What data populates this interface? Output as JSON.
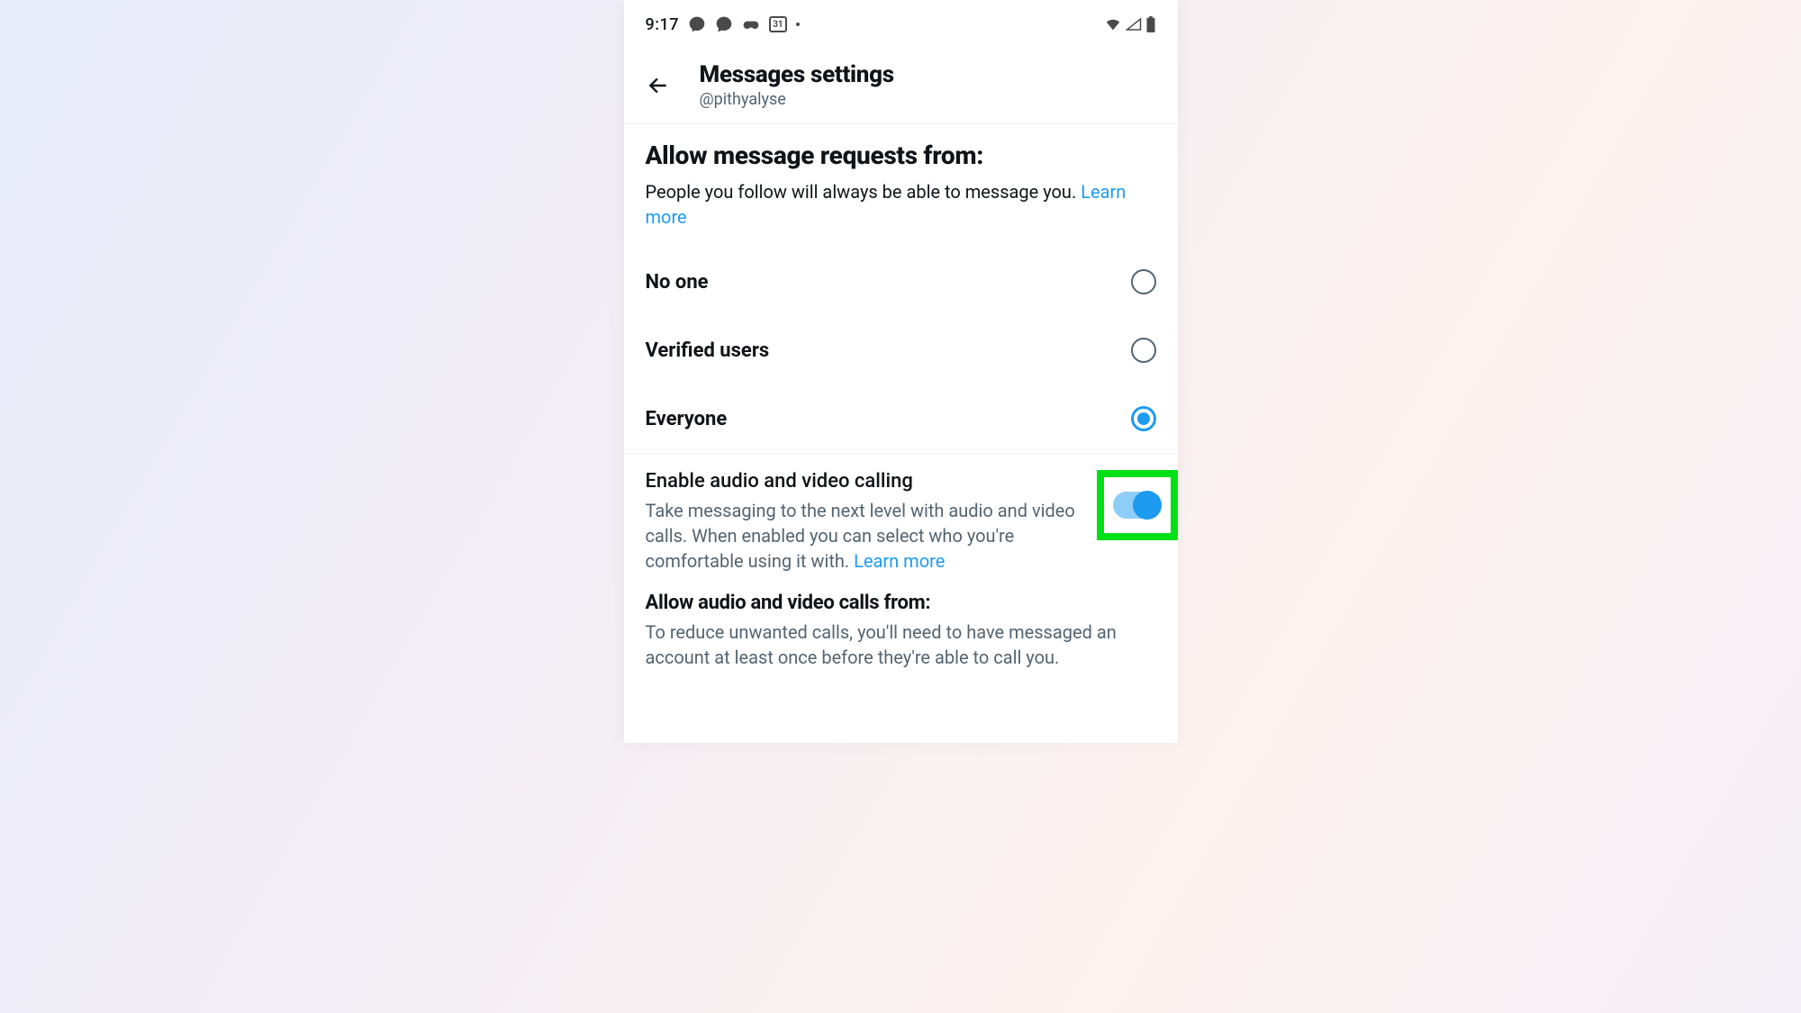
{
  "statusbar": {
    "time": "9:17",
    "calendar_day": "31"
  },
  "header": {
    "title": "Messages settings",
    "handle": "@pithyalyse"
  },
  "allow_requests": {
    "title": "Allow message requests from:",
    "description": "People you follow will always be able to message you. ",
    "learn_more": "Learn more",
    "options": [
      {
        "label": "No one",
        "selected": false
      },
      {
        "label": "Verified users",
        "selected": false
      },
      {
        "label": "Everyone",
        "selected": true
      }
    ]
  },
  "calling": {
    "title": "Enable audio and video calling",
    "description": "Take messaging to the next level with audio and video calls. When enabled you can select who you're comfortable using it with. ",
    "learn_more": "Learn more",
    "enabled": true
  },
  "allow_calls": {
    "title": "Allow audio and video calls from:",
    "description": "To reduce unwanted calls, you'll need to have messaged an account at least once before they're able to call you."
  }
}
